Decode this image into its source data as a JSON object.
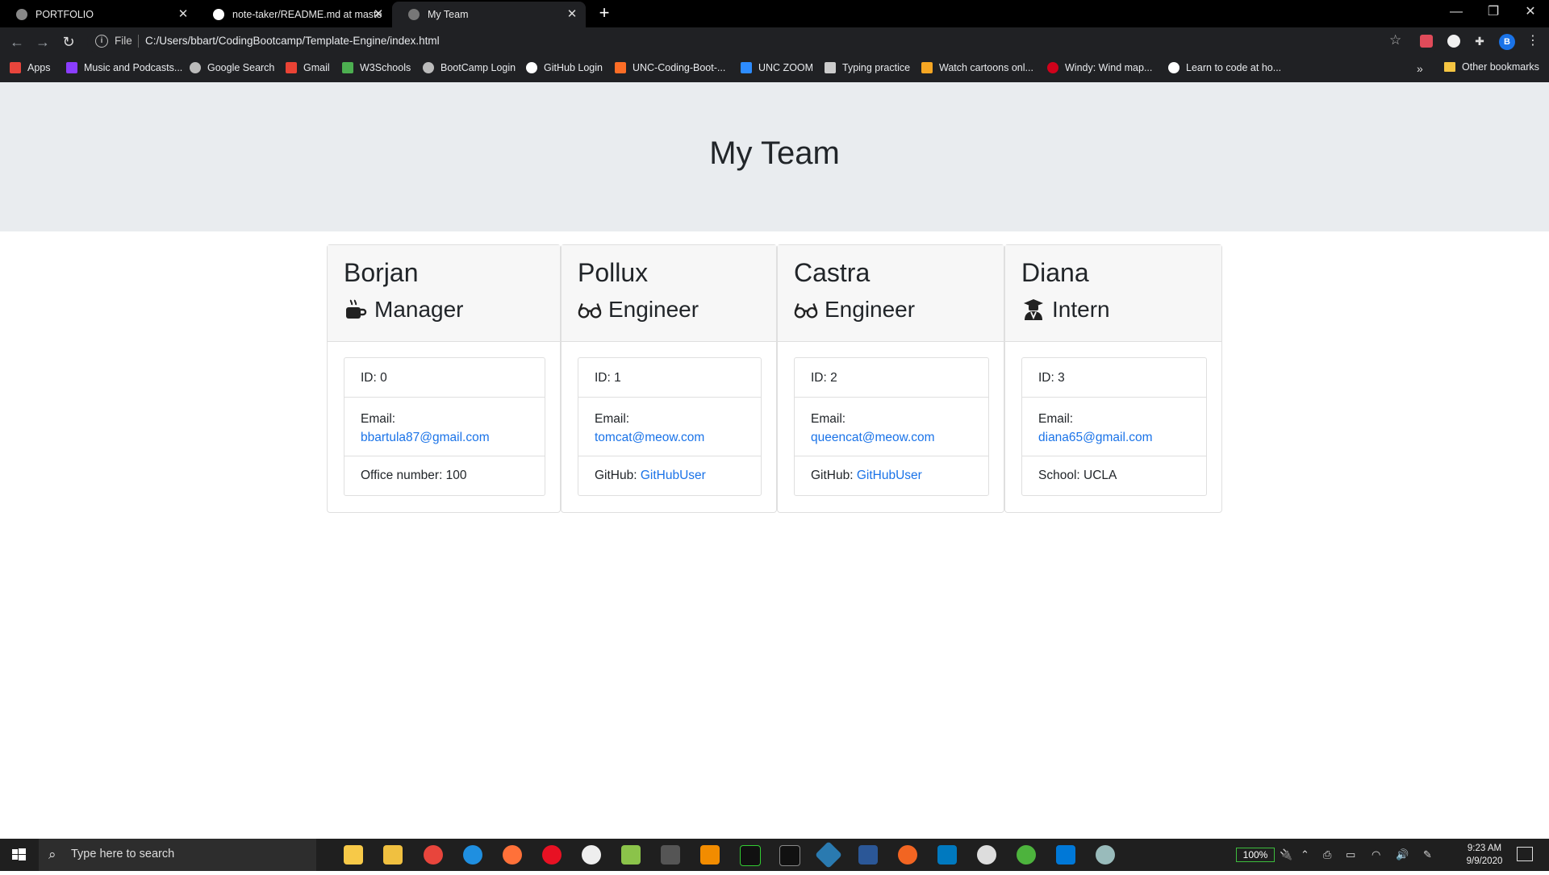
{
  "browser": {
    "tabs": [
      {
        "title": "PORTFOLIO",
        "active": false
      },
      {
        "title": "note-taker/README.md at maste",
        "active": false
      },
      {
        "title": "My Team",
        "active": true
      }
    ],
    "address": {
      "scheme_label": "File",
      "url": "C:/Users/bbart/CodingBootcamp/Template-Engine/index.html"
    },
    "profile_initial": "B",
    "bookmarks": [
      {
        "label": "Apps",
        "icon": "apps-grid-icon",
        "color": "#e8453c"
      },
      {
        "label": "Music and Podcasts...",
        "icon": "music-icon",
        "color": "#8b3dff"
      },
      {
        "label": "Google Search",
        "icon": "globe-icon",
        "color": "#bbbbbb"
      },
      {
        "label": "Gmail",
        "icon": "gmail-icon",
        "color": "#ea4335"
      },
      {
        "label": "W3Schools",
        "icon": "w3schools-icon",
        "color": "#4caf50"
      },
      {
        "label": "BootCamp Login",
        "icon": "globe-icon",
        "color": "#bbbbbb"
      },
      {
        "label": "GitHub Login",
        "icon": "github-icon",
        "color": "#ffffff"
      },
      {
        "label": "UNC-Coding-Boot-...",
        "icon": "gitlab-icon",
        "color": "#fc6d26"
      },
      {
        "label": "UNC ZOOM",
        "icon": "zoom-icon",
        "color": "#2d8cff"
      },
      {
        "label": "Typing practice",
        "icon": "doc-icon",
        "color": "#cccccc"
      },
      {
        "label": "Watch cartoons onl...",
        "icon": "cartoon-icon",
        "color": "#f5a623"
      },
      {
        "label": "Windy: Wind map...",
        "icon": "windy-icon",
        "color": "#d0021b"
      },
      {
        "label": "Learn to code at ho...",
        "icon": "codecademy-icon",
        "color": "#ffffff"
      }
    ],
    "other_bookmarks": "Other bookmarks"
  },
  "page": {
    "title": "My Team",
    "employees": [
      {
        "name": "Borjan",
        "role": "Manager",
        "icon": "mug-icon",
        "id": "ID: 0",
        "email_label": "Email:",
        "email": "bbartula87@gmail.com",
        "extra_label": "Office number: 100",
        "extra_link": ""
      },
      {
        "name": "Pollux",
        "role": "Engineer",
        "icon": "glasses-icon",
        "id": "ID: 1",
        "email_label": "Email:",
        "email": "tomcat@meow.com",
        "extra_label": "GitHub: ",
        "extra_link": "GitHubUser"
      },
      {
        "name": "Castra",
        "role": "Engineer",
        "icon": "glasses-icon",
        "id": "ID: 2",
        "email_label": "Email:",
        "email": "queencat@meow.com",
        "extra_label": "GitHub: ",
        "extra_link": "GitHubUser"
      },
      {
        "name": "Diana",
        "role": "Intern",
        "icon": "graduate-icon",
        "id": "ID: 3",
        "email_label": "Email:",
        "email": "diana65@gmail.com",
        "extra_label": "School: UCLA",
        "extra_link": ""
      }
    ]
  },
  "taskbar": {
    "search_placeholder": "Type here to search",
    "battery": "100%",
    "time": "9:23 AM",
    "date": "9/9/2020"
  }
}
